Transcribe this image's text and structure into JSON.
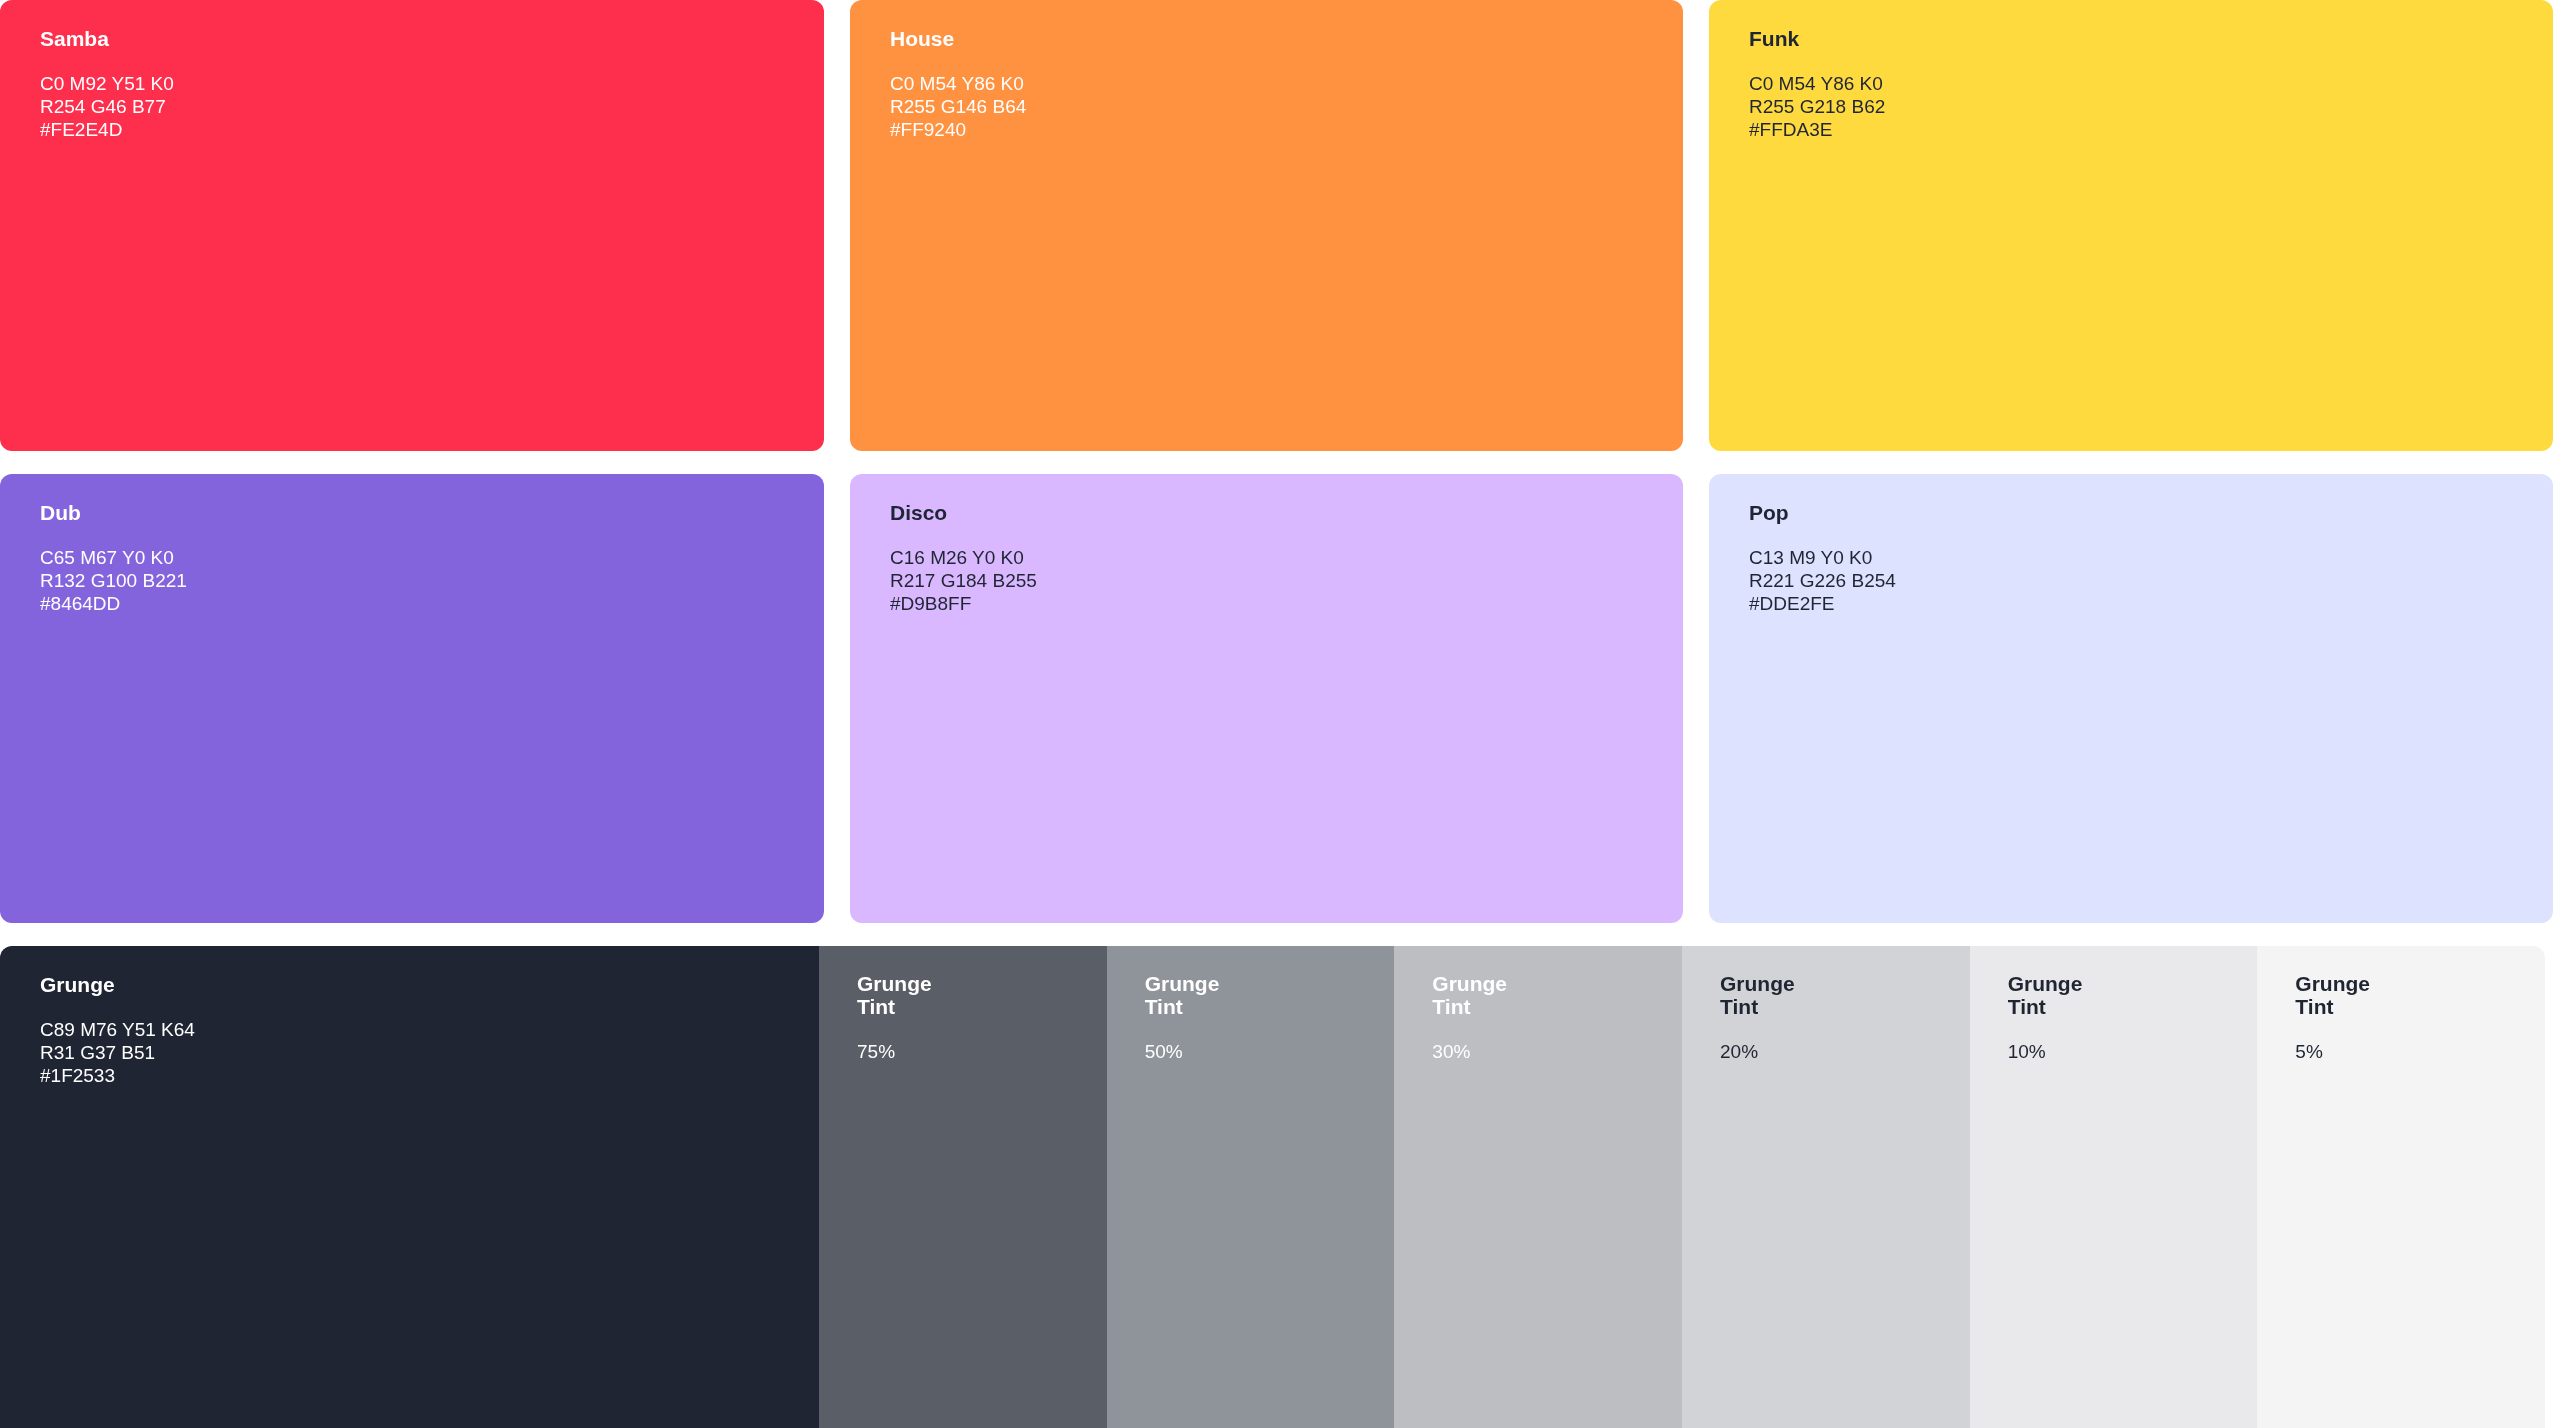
{
  "swatches": [
    {
      "name": "Samba",
      "color": "#fe2e4d",
      "kind": "light",
      "lines": [
        "C0 M92 Y51 K0",
        "R254 G46 B77",
        "#FE2E4D"
      ]
    },
    {
      "name": "House",
      "color": "#ff9240",
      "kind": "light",
      "lines": [
        "C0 M54 Y86 K0",
        "R255 G146 B64",
        "#FF9240"
      ]
    },
    {
      "name": "Funk",
      "color": "#ffda3e",
      "kind": "dark",
      "lines": [
        "C0 M54 Y86 K0",
        "R255 G218 B62",
        "#FFDA3E"
      ]
    },
    {
      "name": "Dub",
      "color": "#8464dd",
      "kind": "light",
      "lines": [
        "C65 M67 Y0 K0",
        "R132 G100 B221",
        "#8464DD"
      ]
    },
    {
      "name": "Disco",
      "color": "#d9b8ff",
      "kind": "dark",
      "lines": [
        "C16 M26 Y0 K0",
        "R217 G184 B255",
        "#D9B8FF"
      ]
    },
    {
      "name": "Pop",
      "color": "#dde2fe",
      "kind": "dark",
      "lines": [
        "C13 M9 Y0 K0",
        "R221 G226 B254",
        "#DDE2FE"
      ]
    }
  ],
  "base": {
    "name": "Grunge",
    "color": "#1f2533",
    "kind": "light",
    "lines": [
      "C89 M76 Y51 K64",
      "R31 G37 B51",
      "#1F2533"
    ]
  },
  "tints": [
    {
      "name": "Grunge\nTint",
      "value": "75%",
      "color": "#5a5e67",
      "kind": "light"
    },
    {
      "name": "Grunge\nTint",
      "value": "50%",
      "color": "#8f939a",
      "kind": "light"
    },
    {
      "name": "Grunge\nTint",
      "value": "30%",
      "color": "#bcbec2",
      "kind": "light"
    },
    {
      "name": "Grunge\nTint",
      "value": "20%",
      "color": "#d2d3d6",
      "kind": "dark"
    },
    {
      "name": "Grunge\nTint",
      "value": "10%",
      "color": "#e9e9eb",
      "kind": "dark"
    },
    {
      "name": "Grunge\nTint",
      "value": "5%",
      "color": "#f4f4f5",
      "kind": "dark"
    }
  ]
}
